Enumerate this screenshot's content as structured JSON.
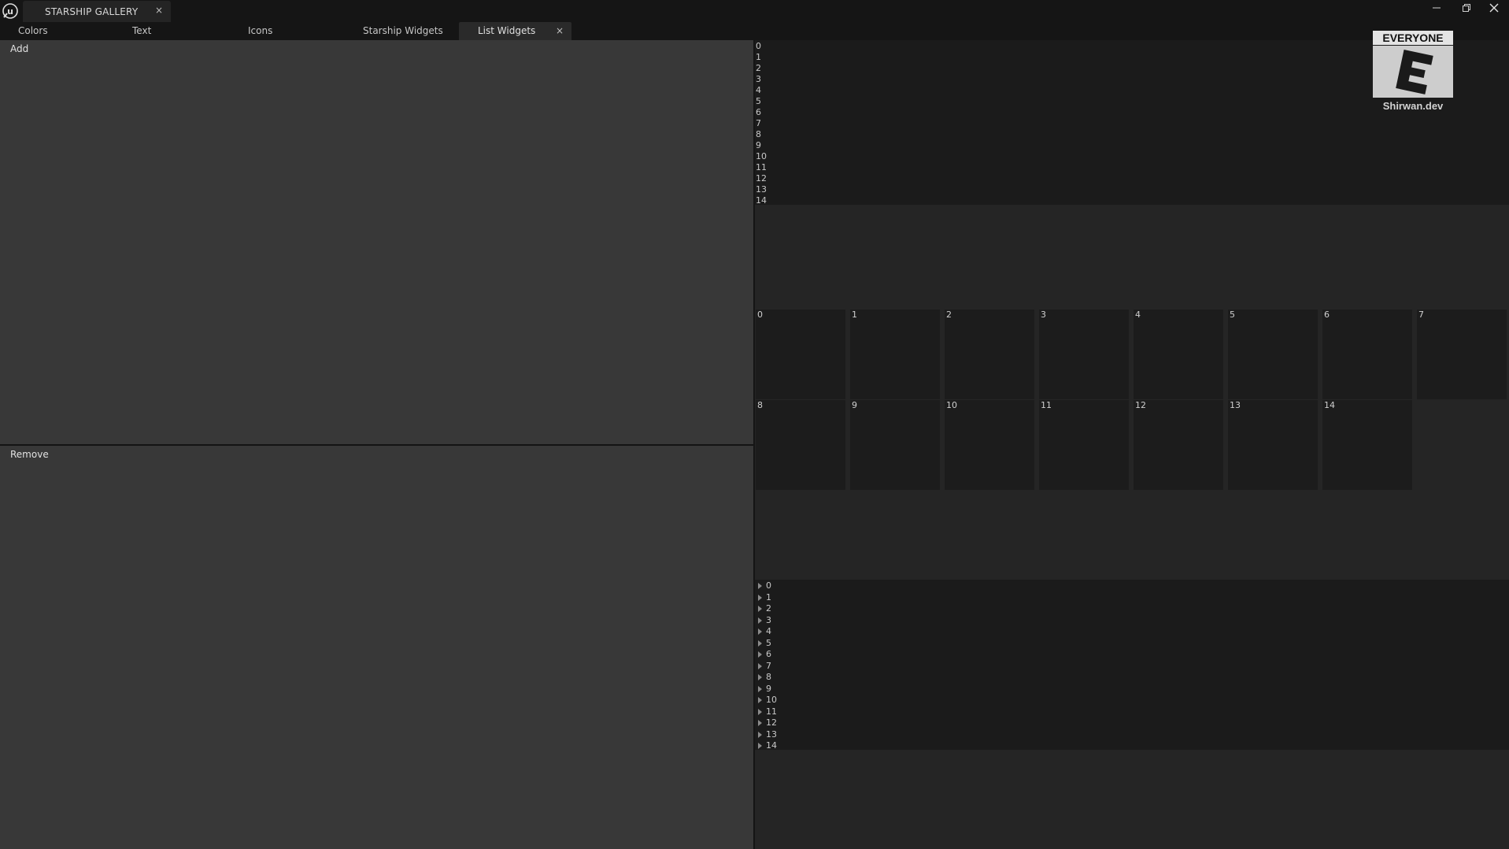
{
  "window": {
    "tab_title": "STARSHIP GALLERY",
    "tab_close": "×"
  },
  "tabs": [
    {
      "label": "Colors"
    },
    {
      "label": "Text"
    },
    {
      "label": "Icons"
    },
    {
      "label": "Starship Widgets"
    },
    {
      "label": "List Widgets",
      "active": true,
      "close": "×"
    }
  ],
  "add_panel": {
    "button_label": "Add"
  },
  "remove_panel": {
    "button_label": "Remove"
  },
  "list_view": {
    "items": [
      "0",
      "1",
      "2",
      "3",
      "4",
      "5",
      "6",
      "7",
      "8",
      "9",
      "10",
      "11",
      "12",
      "13",
      "14"
    ]
  },
  "tile_view": {
    "items": [
      "0",
      "1",
      "2",
      "3",
      "4",
      "5",
      "6",
      "7",
      "8",
      "9",
      "10",
      "11",
      "12",
      "13",
      "14"
    ]
  },
  "tree_view": {
    "items": [
      "0",
      "1",
      "2",
      "3",
      "4",
      "5",
      "6",
      "7",
      "8",
      "9",
      "10",
      "11",
      "12",
      "13",
      "14"
    ]
  },
  "badge": {
    "rating": "EVERYONE",
    "letter": "E",
    "site": "Shirwan.dev"
  },
  "colors": {
    "panel_bg": "#383838",
    "list_bg": "#1b1b1b",
    "right_bg": "#252525",
    "titlebar_bg": "#151515"
  }
}
